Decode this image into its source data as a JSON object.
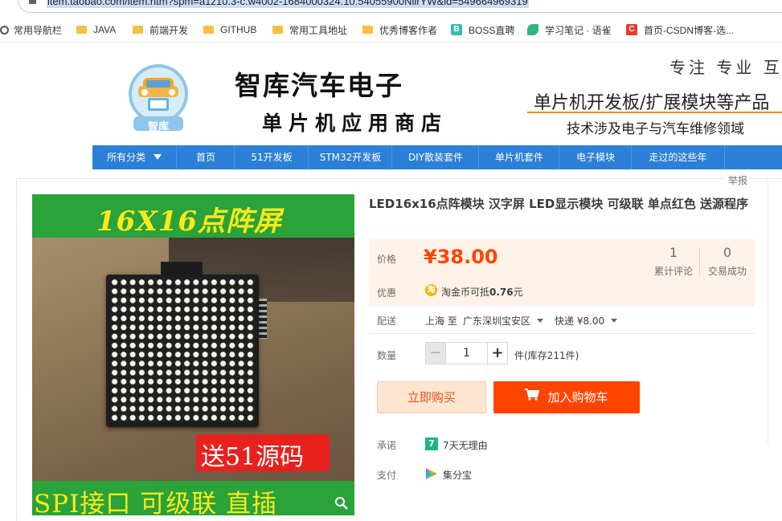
{
  "browser": {
    "url": "item.taobao.com/item.htm?spm=a1z10.3-c.w4002-1684000324.10.54055900NiirYW&id=549664969319"
  },
  "bookmarks": [
    {
      "label": "常用导航栏",
      "icon": "gear-icon"
    },
    {
      "label": "JAVA",
      "icon": "folder-icon"
    },
    {
      "label": "前端开发",
      "icon": "folder-icon"
    },
    {
      "label": "GITHUB",
      "icon": "folder-icon"
    },
    {
      "label": "常用工具地址",
      "icon": "folder-icon"
    },
    {
      "label": "优秀博客作者",
      "icon": "folder-icon"
    },
    {
      "label": "BOSS直聘",
      "icon": "boss-icon"
    },
    {
      "label": "学习笔记 · 语雀",
      "icon": "yuque-icon"
    },
    {
      "label": "首页-CSDN博客-选...",
      "icon": "csdn-icon"
    }
  ],
  "shop": {
    "logo_text": "智库",
    "name": "智库汽车电子",
    "subtitle": "单片机应用商店",
    "slogan_top": "专注 专业 互",
    "slogan_main": "单片机开发板/扩展模块等产品",
    "slogan_sub": "技术涉及电子与汽车维修领域"
  },
  "nav": {
    "items": [
      "所有分类",
      "首页",
      "51开发板",
      "STM32开发板",
      "DIY散装套件",
      "单片机套件",
      "电子模块",
      "走过的这些年"
    ]
  },
  "report_label": "举报",
  "product_image": {
    "title": "16X16点阵屏",
    "badge": "送51源码",
    "bottom": "SPI接口 可级联 直插"
  },
  "product": {
    "title": "LED16x16点阵模块 汉字屏 LED显示模块 可级联 单点红色 送源程序",
    "price_label": "价格",
    "price": "¥38.00",
    "reviews_count": "1",
    "reviews_label": "累计评论",
    "deals_count": "0",
    "deals_label": "交易成功",
    "promo_label": "优惠",
    "promo_text_pre": "淘金币可抵",
    "promo_amount": "0.76",
    "promo_unit": "元",
    "ship_label": "配送",
    "ship_from": "上海 至",
    "ship_to": "广东深圳宝安区",
    "ship_method": "快递 ¥8.00",
    "qty_label": "数量",
    "qty_value": "1",
    "stock_text": "件(库存211件)",
    "buy_now": "立即购买",
    "add_cart": "加入购物车",
    "promise_label": "承诺",
    "promise_text": "7天无理由",
    "pay_label": "支付",
    "pay_text": "集分宝"
  },
  "colors": {
    "nav_blue": "#2c7fd6",
    "price_orange": "#ff4400",
    "image_green": "#29a33a"
  }
}
